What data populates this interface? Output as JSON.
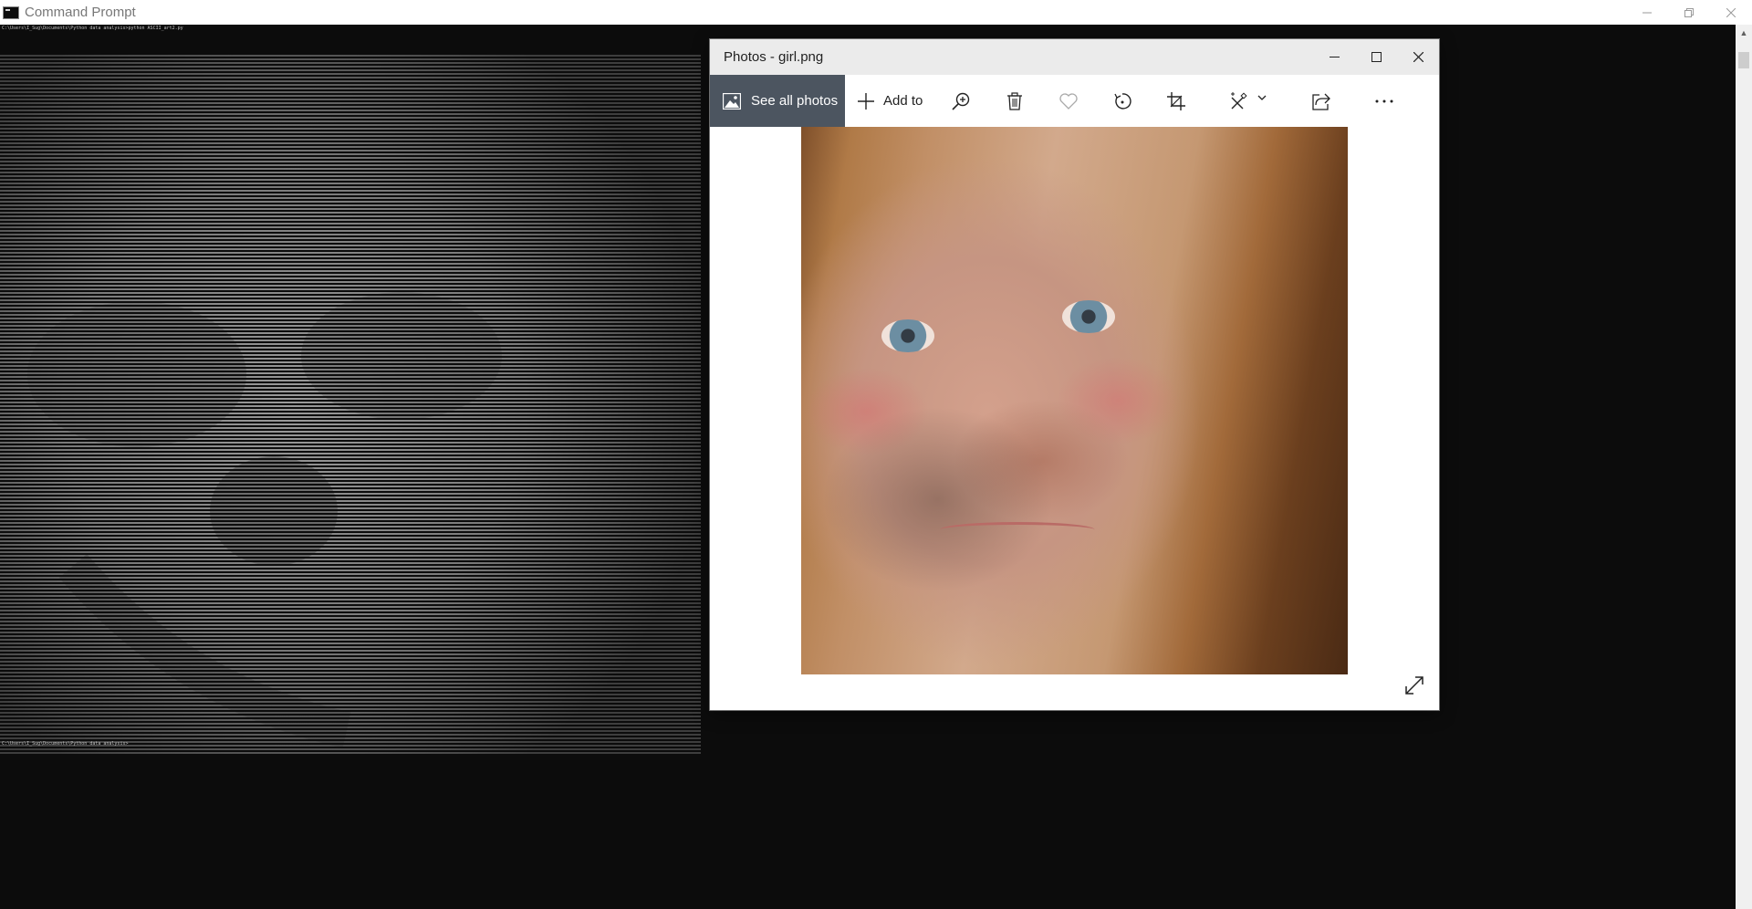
{
  "cmd": {
    "title": "Command Prompt",
    "command_line": "C:\\Users\\I_Sug\\Documents\\Python data analysis>python ASCII_art2.py",
    "prompt_line": "C:\\Users\\I_Sug\\Documents\\Python data analysis>"
  },
  "photos": {
    "title": "Photos - girl.png",
    "toolbar": {
      "see_all_label": "See all photos",
      "add_to_label": "Add to"
    }
  }
}
